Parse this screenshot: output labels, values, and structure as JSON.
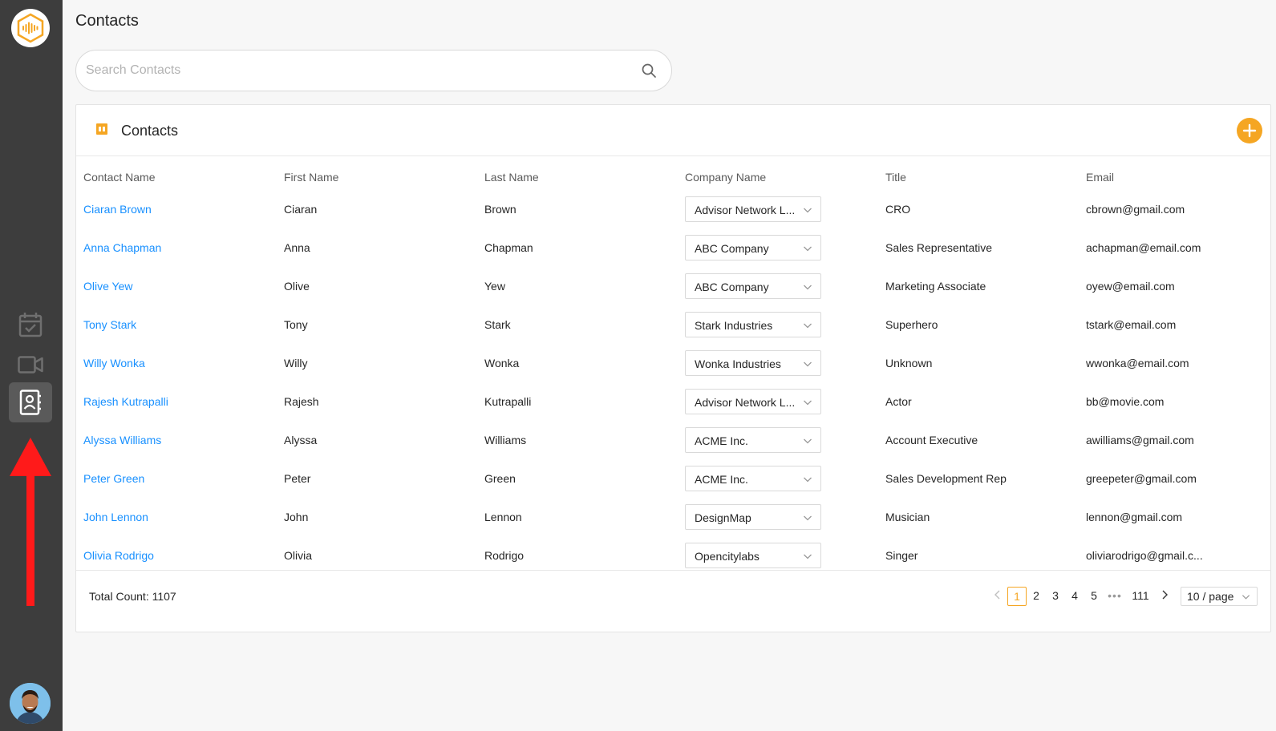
{
  "page": {
    "title": "Contacts"
  },
  "search": {
    "placeholder": "Search Contacts"
  },
  "card": {
    "title": "Contacts"
  },
  "table": {
    "headers": [
      "Contact Name",
      "First Name",
      "Last Name",
      "Company Name",
      "Title",
      "Email"
    ],
    "rows": [
      {
        "contact_name": "Ciaran Brown",
        "first": "Ciaran",
        "last": "Brown",
        "company": "Advisor Network L...",
        "title": "CRO",
        "email": "cbrown@gmail.com"
      },
      {
        "contact_name": "Anna Chapman",
        "first": "Anna",
        "last": "Chapman",
        "company": "ABC Company",
        "title": "Sales Representative",
        "email": "achapman@email.com"
      },
      {
        "contact_name": "Olive Yew",
        "first": "Olive",
        "last": "Yew",
        "company": "ABC Company",
        "title": "Marketing Associate",
        "email": "oyew@email.com"
      },
      {
        "contact_name": "Tony Stark",
        "first": "Tony",
        "last": "Stark",
        "company": "Stark Industries",
        "title": "Superhero",
        "email": "tstark@email.com"
      },
      {
        "contact_name": "Willy Wonka",
        "first": "Willy",
        "last": "Wonka",
        "company": "Wonka Industries",
        "title": "Unknown",
        "email": "wwonka@email.com"
      },
      {
        "contact_name": "Rajesh Kutrapalli",
        "first": "Rajesh",
        "last": "Kutrapalli",
        "company": "Advisor Network L...",
        "title": "Actor",
        "email": "bb@movie.com"
      },
      {
        "contact_name": "Alyssa Williams",
        "first": "Alyssa",
        "last": "Williams",
        "company": "ACME Inc.",
        "title": "Account Executive",
        "email": "awilliams@gmail.com"
      },
      {
        "contact_name": "Peter Green",
        "first": "Peter",
        "last": "Green",
        "company": "ACME Inc.",
        "title": "Sales Development Rep",
        "email": "greepeter@gmail.com"
      },
      {
        "contact_name": "John Lennon",
        "first": "John",
        "last": "Lennon",
        "company": "DesignMap",
        "title": "Musician",
        "email": "lennon@gmail.com"
      },
      {
        "contact_name": "Olivia Rodrigo",
        "first": "Olivia",
        "last": "Rodrigo",
        "company": "Opencitylabs",
        "title": "Singer",
        "email": "oliviarodrigo@gmail.c..."
      }
    ]
  },
  "footer": {
    "total": "Total Count: 1107",
    "pages": [
      "1",
      "2",
      "3",
      "4",
      "5"
    ],
    "dots": "•••",
    "last_page": "111",
    "page_size": "10 / page",
    "current_page": "1"
  },
  "colors": {
    "accent": "#f5a623",
    "link": "#1890ff",
    "sidebar": "#3d3d3d",
    "annotation_arrow": "#ff1a1a"
  },
  "sidebar": {
    "icons": [
      "logo-icon",
      "tasks-icon",
      "video-icon",
      "contacts-icon",
      "avatar"
    ],
    "active": "contacts-icon"
  }
}
